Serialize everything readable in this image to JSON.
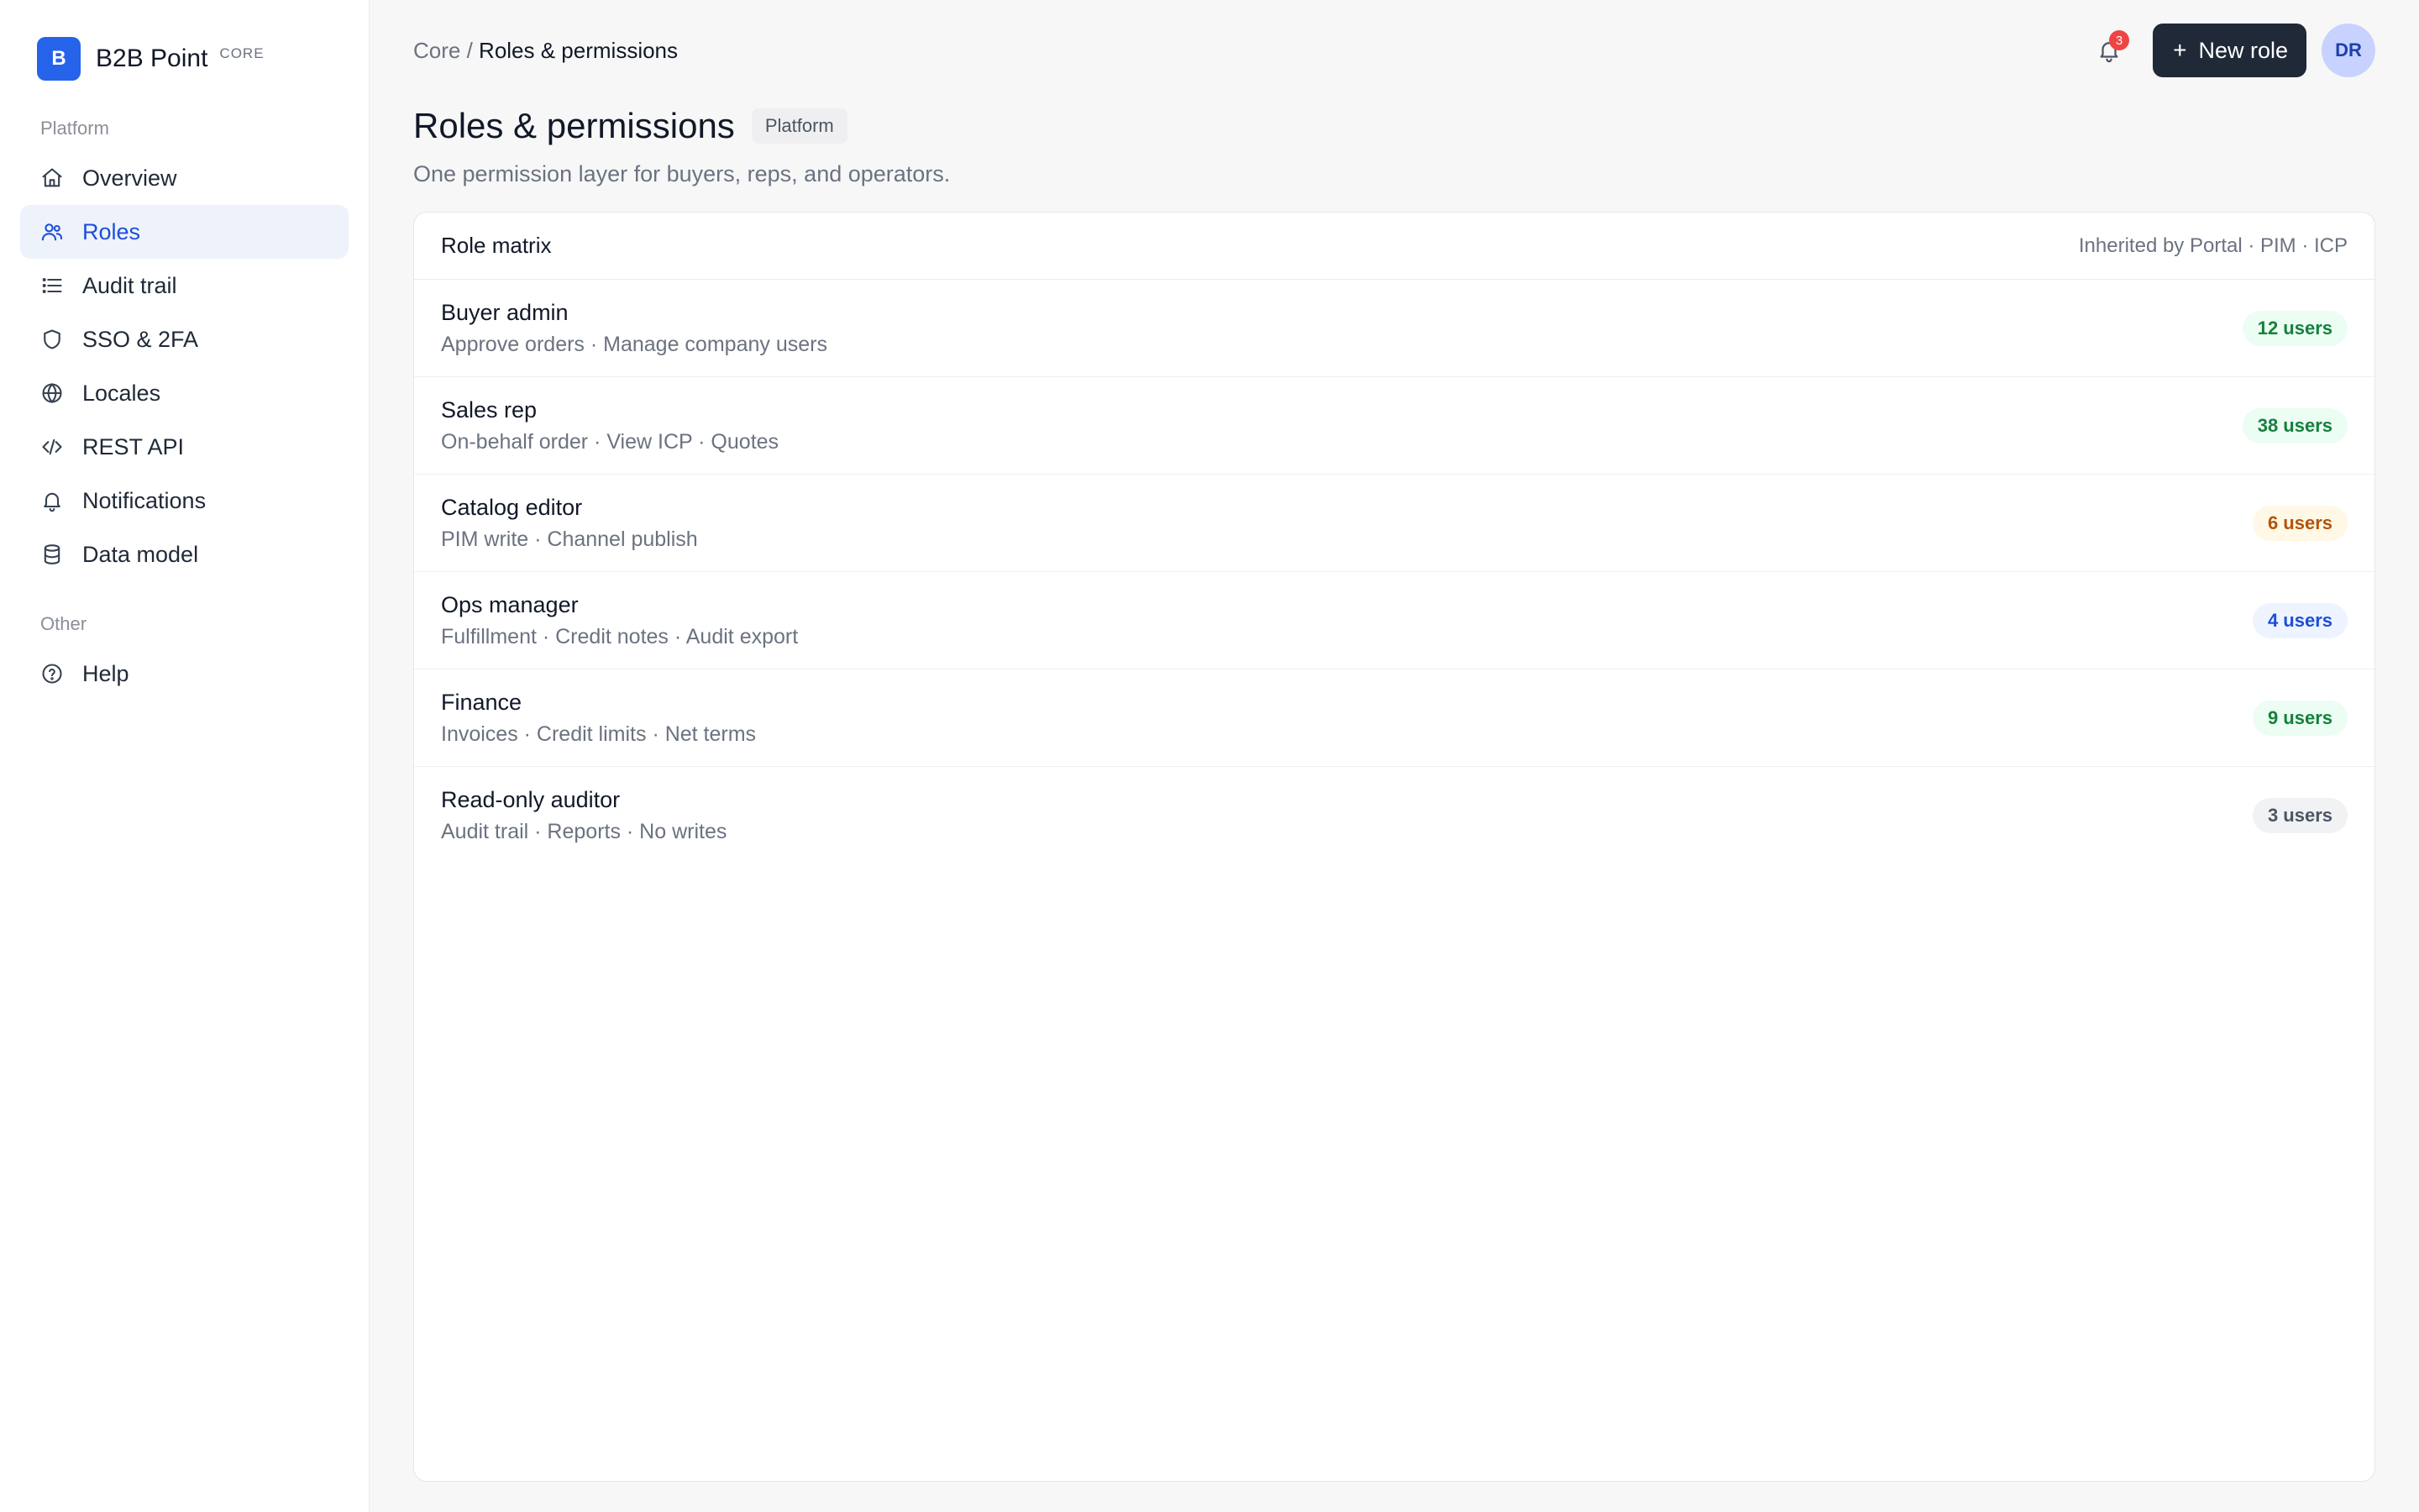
{
  "brand": {
    "logo_letter": "B",
    "name": "B2B Point",
    "tag": "CORE"
  },
  "sidebar": {
    "section_platform": "Platform",
    "items": [
      {
        "label": "Overview",
        "icon": "home-icon"
      },
      {
        "label": "Roles",
        "icon": "users-icon",
        "active": true
      },
      {
        "label": "Audit trail",
        "icon": "list-icon"
      },
      {
        "label": "SSO & 2FA",
        "icon": "shield-icon"
      },
      {
        "label": "Locales",
        "icon": "globe-icon"
      },
      {
        "label": "REST API",
        "icon": "code-icon"
      },
      {
        "label": "Notifications",
        "icon": "bell-icon"
      },
      {
        "label": "Data model",
        "icon": "database-icon"
      }
    ],
    "section_other": "Other",
    "other_items": [
      {
        "label": "Help",
        "icon": "help-circle-icon"
      }
    ]
  },
  "header": {
    "breadcrumb_parent": "Core /",
    "breadcrumb_current": "Roles & permissions",
    "notifications_count": "3",
    "new_role_label": "New role",
    "avatar_initials": "DR"
  },
  "page": {
    "title": "Roles & permissions",
    "badge": "Platform",
    "subtitle": "One permission layer for buyers, reps, and operators."
  },
  "matrix": {
    "title": "Role matrix",
    "meta": "Inherited by Portal · PIM · ICP",
    "roles": [
      {
        "name": "Buyer admin",
        "permissions": "Approve orders · Manage company users",
        "users": "12 users",
        "tone": "green"
      },
      {
        "name": "Sales rep",
        "permissions": "On-behalf order · View ICP · Quotes",
        "users": "38 users",
        "tone": "green"
      },
      {
        "name": "Catalog editor",
        "permissions": "PIM write · Channel publish",
        "users": "6 users",
        "tone": "amber"
      },
      {
        "name": "Ops manager",
        "permissions": "Fulfillment · Credit notes · Audit export",
        "users": "4 users",
        "tone": "blue"
      },
      {
        "name": "Finance",
        "permissions": "Invoices · Credit limits · Net terms",
        "users": "9 users",
        "tone": "green"
      },
      {
        "name": "Read-only auditor",
        "permissions": "Audit trail · Reports · No writes",
        "users": "3 users",
        "tone": "gray"
      }
    ]
  },
  "colors": {
    "accent": "#2563eb",
    "primary_button": "#1f2937",
    "active_nav_bg": "#eef3fb",
    "badge_red": "#ef4444"
  }
}
